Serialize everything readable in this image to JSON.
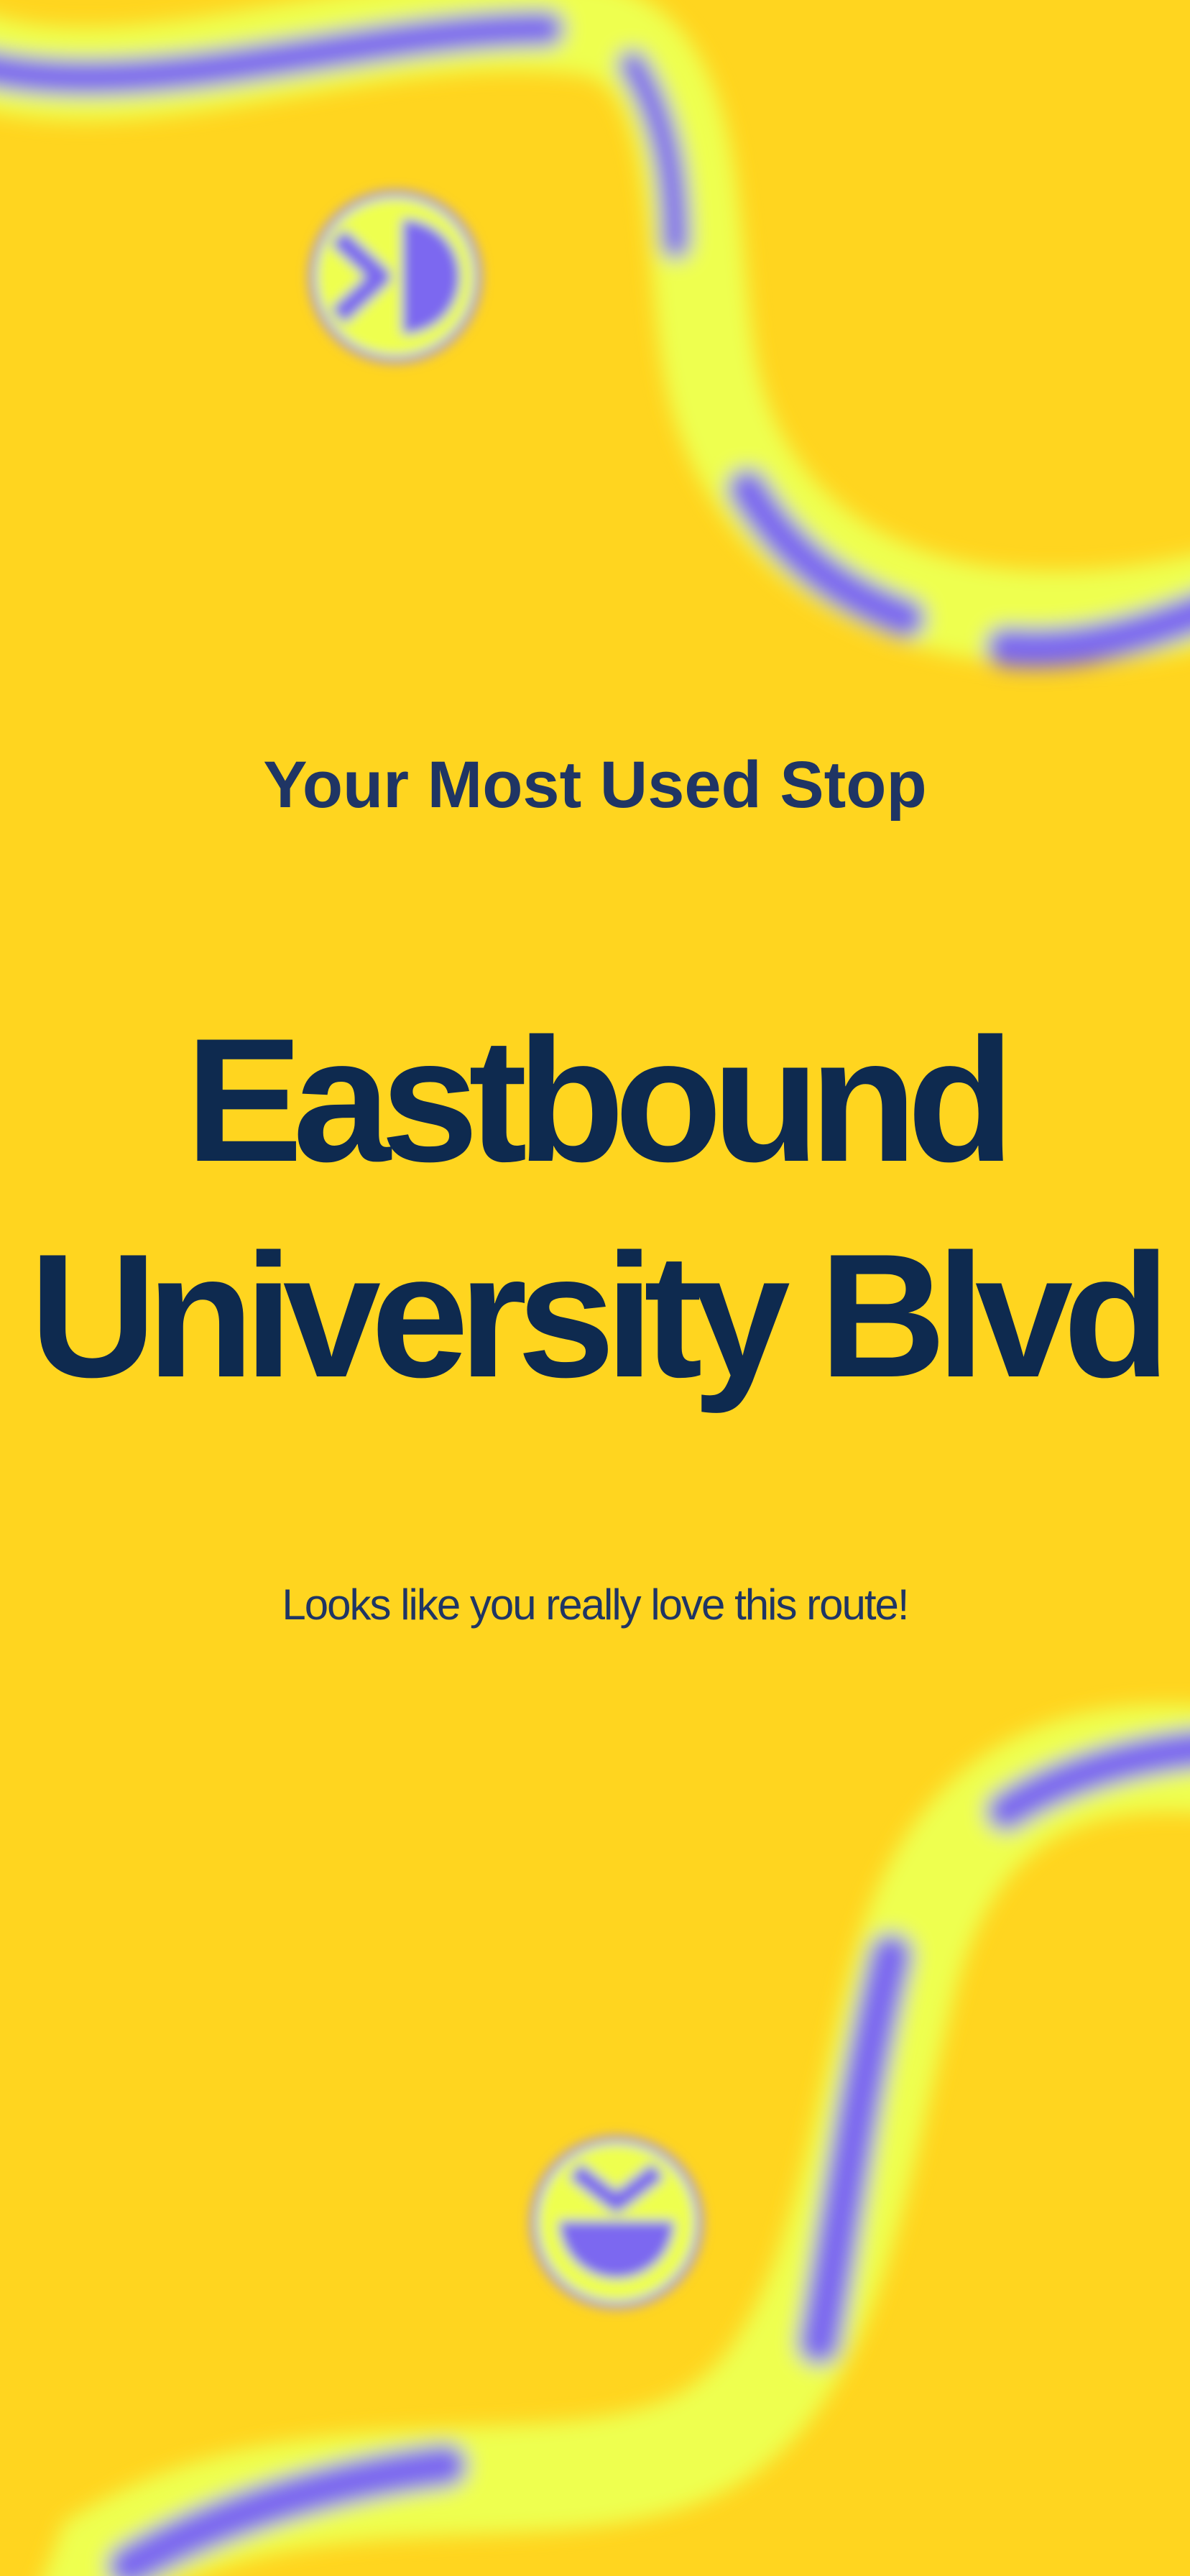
{
  "card": {
    "eyebrow": "Your Most Used Stop",
    "headline_line1": "Eastbound",
    "headline_line2": "University Blvd",
    "subline": "Looks like you really love this route!"
  },
  "theme": {
    "background": "#FFD51F",
    "text_dark": "#0E2A4F",
    "ribbon_light": "#EEFF4F",
    "ribbon_accent": "#7B68F0"
  },
  "icons": {
    "top_emblem": "smiley-emblem-icon",
    "bottom_emblem": "smiley-emblem-icon"
  }
}
